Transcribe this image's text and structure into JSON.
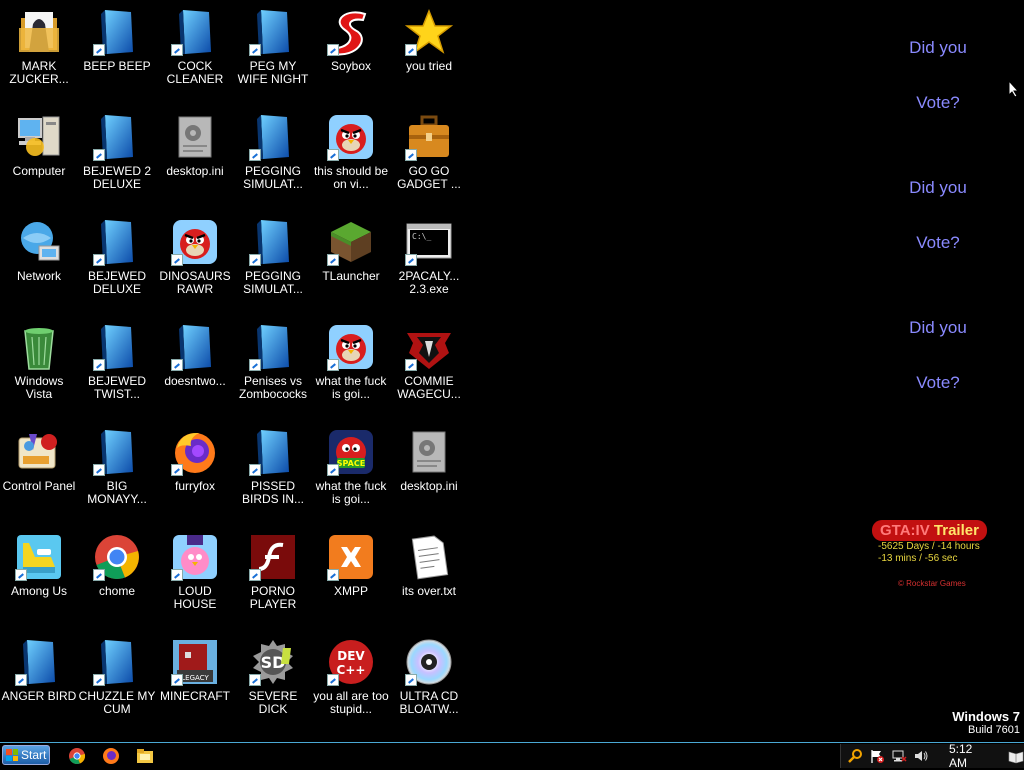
{
  "desktop": {
    "icons": [
      {
        "label": "MARK ZUCKER...",
        "icon": "folder-icon"
      },
      {
        "label": "BEEP BEEP",
        "icon": "blue-app-icon"
      },
      {
        "label": "COCK CLEANER",
        "icon": "blue-app-icon"
      },
      {
        "label": "PEG MY WIFE NIGHT",
        "icon": "blue-app-icon"
      },
      {
        "label": "Soybox",
        "icon": "s-logo-icon"
      },
      {
        "label": "you tried",
        "icon": "star-icon"
      },
      {
        "label": "Computer",
        "icon": "computer-icon"
      },
      {
        "label": "BEJEWED 2 DELUXE",
        "icon": "blue-app-icon"
      },
      {
        "label": "desktop.ini",
        "icon": "settings-file-icon"
      },
      {
        "label": "PEGGING SIMULAT...",
        "icon": "blue-app-icon"
      },
      {
        "label": "this should be on vi...",
        "icon": "angry-bird-icon"
      },
      {
        "label": "GO GO GADGET ...",
        "icon": "briefcase-icon"
      },
      {
        "label": "Network",
        "icon": "network-icon"
      },
      {
        "label": "BEJEWED DELUXE",
        "icon": "blue-app-icon"
      },
      {
        "label": "DINOSAURS RAWR",
        "icon": "angry-bird-icon"
      },
      {
        "label": "PEGGING SIMULAT...",
        "icon": "blue-app-icon"
      },
      {
        "label": "TLauncher",
        "icon": "grass-block-icon"
      },
      {
        "label": "2PACALY... 2.3.exe",
        "icon": "console-icon"
      },
      {
        "label": "Windows Vista",
        "icon": "recycle-bin-icon"
      },
      {
        "label": "BEJEWED TWIST...",
        "icon": "blue-app-icon"
      },
      {
        "label": "doesntwo...",
        "icon": "blue-app-icon"
      },
      {
        "label": "Penises vs Zombococks",
        "icon": "blue-app-icon"
      },
      {
        "label": "what the fuck is goi...",
        "icon": "angry-bird-icon"
      },
      {
        "label": "COMMIE WAGECU...",
        "icon": "emblem-icon"
      },
      {
        "label": "Control Panel",
        "icon": "control-panel-icon"
      },
      {
        "label": "BIG MONAYY...",
        "icon": "blue-app-icon"
      },
      {
        "label": "furryfox",
        "icon": "firefox-icon"
      },
      {
        "label": "PISSED BIRDS IN...",
        "icon": "blue-app-icon"
      },
      {
        "label": "what the fuck is goi...",
        "icon": "angry-bird-space-icon"
      },
      {
        "label": "desktop.ini",
        "icon": "settings-file-icon"
      },
      {
        "label": "Among Us",
        "icon": "among-us-icon"
      },
      {
        "label": "chome",
        "icon": "chrome-icon"
      },
      {
        "label": "LOUD HOUSE",
        "icon": "pink-bird-icon"
      },
      {
        "label": "PORNO PLAYER",
        "icon": "flash-icon"
      },
      {
        "label": "XMPP",
        "icon": "xampp-icon"
      },
      {
        "label": "its over.txt",
        "icon": "text-file-icon"
      },
      {
        "label": "ANGER BIRD",
        "icon": "blue-app-icon"
      },
      {
        "label": "CHUZZLE MY CUM",
        "icon": "blue-app-icon"
      },
      {
        "label": "MINECRAFT",
        "icon": "minecraft-icon"
      },
      {
        "label": "SEVERE DICK",
        "icon": "sd-icon"
      },
      {
        "label": "you all are too stupid...",
        "icon": "dev-cpp-icon"
      },
      {
        "label": "ULTRA CD BLOATW...",
        "icon": "cd-icon"
      }
    ]
  },
  "gadget_vote": {
    "lines": [
      "Did you",
      "Vote?",
      "Did you",
      "Vote?",
      "Did you",
      "Vote?"
    ]
  },
  "gadget_gta": {
    "title_part1": "GTA:IV",
    "title_part2": "Trailer",
    "line1": "-5625 Days / -14 hours",
    "line2": "-13 mins / -56 sec",
    "brand": "© Rockstar Games"
  },
  "watermark": {
    "line1": "Windows 7",
    "line2": "Build 7601"
  },
  "taskbar": {
    "start_label": "Start",
    "pinned": [
      "chrome-icon",
      "firefox-icon",
      "explorer-icon"
    ],
    "clock": "5:12 AM"
  },
  "colors": {
    "accent": "#4aa8d4",
    "vote_text": "#8a8aff",
    "gta_red": "#c21010"
  }
}
